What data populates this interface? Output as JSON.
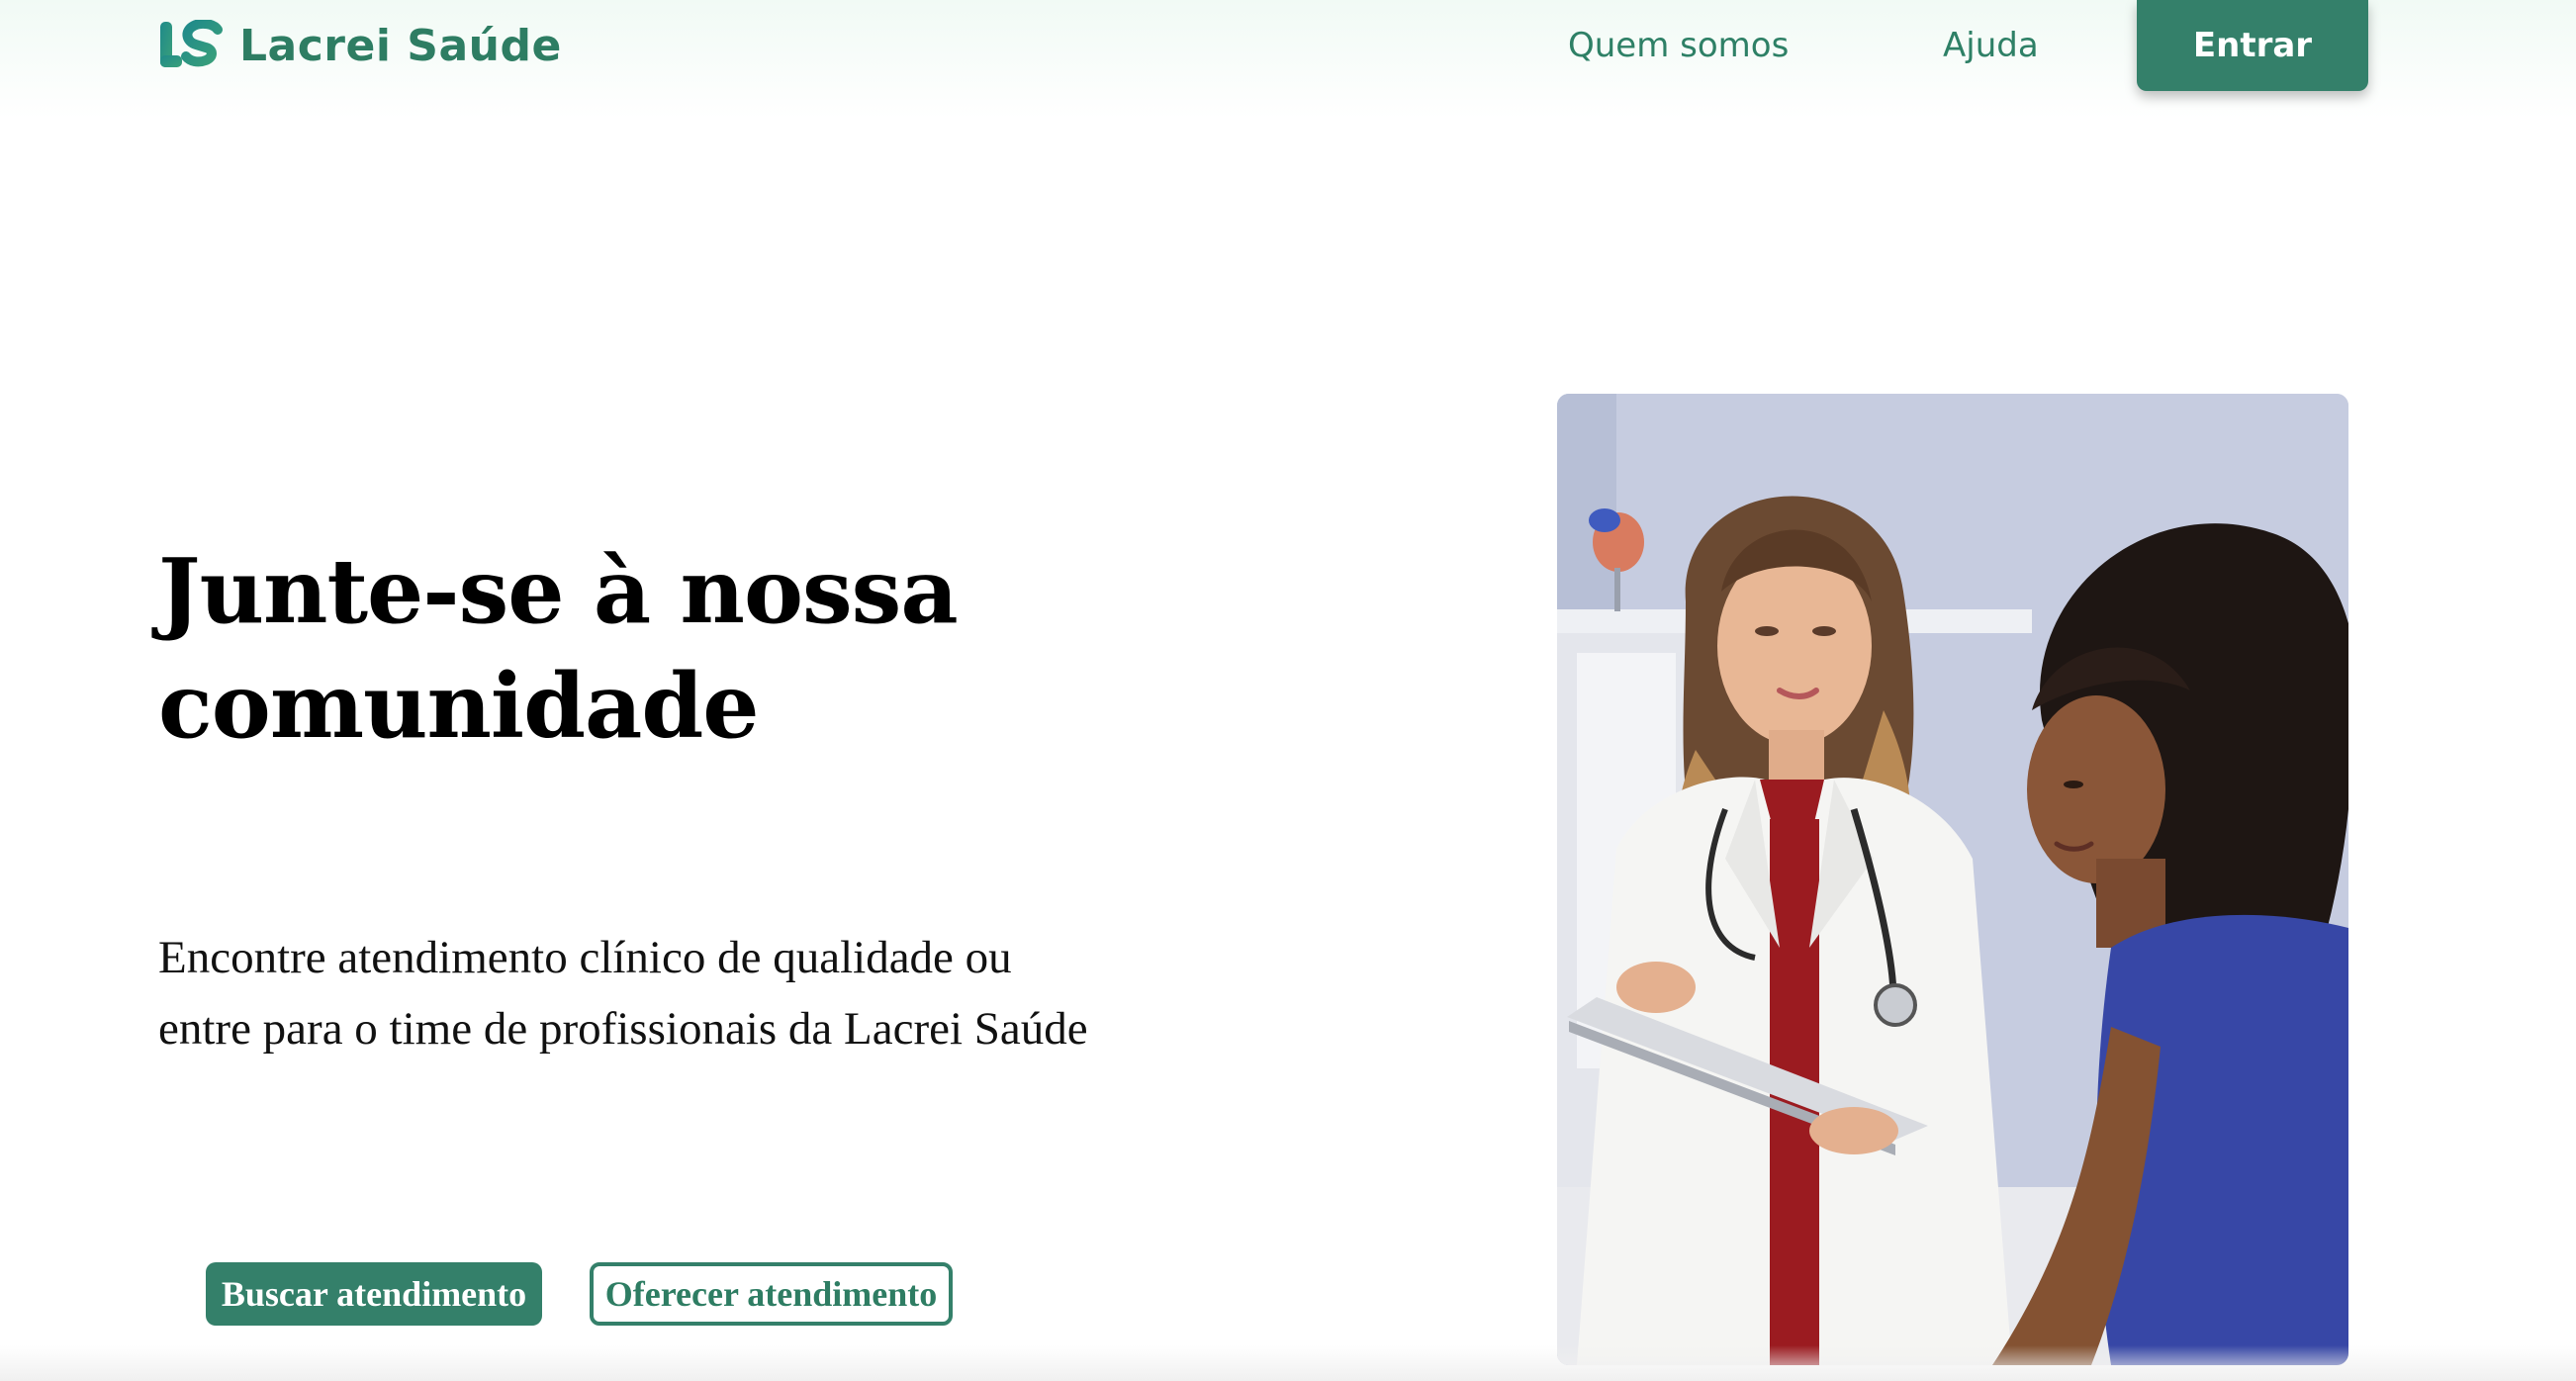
{
  "header": {
    "brand": "Lacrei Saúde",
    "nav": {
      "quem_somos": "Quem somos",
      "ajuda": "Ajuda"
    },
    "login_label": "Entrar"
  },
  "hero": {
    "title_line1": "Junte-se à nossa",
    "title_line2": "comunidade",
    "subtitle_line1": "Encontre atendimento clínico de qualidade ou",
    "subtitle_line2": "entre para o time de profissionais da Lacrei Saúde",
    "primary_cta": "Buscar atendimento",
    "secondary_cta": "Oferecer atendimento"
  },
  "colors": {
    "brand_green": "#34806a",
    "brand_text": "#2e7d63"
  },
  "icons": {
    "logo": "lacrei-logo-icon"
  }
}
